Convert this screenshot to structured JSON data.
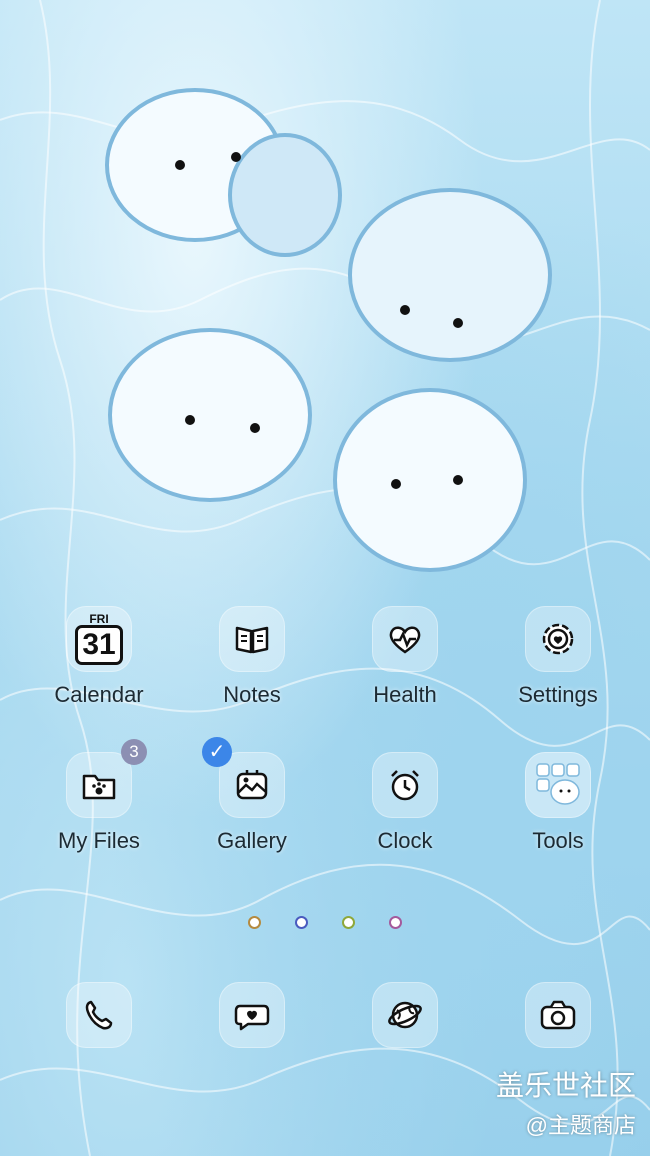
{
  "calendar": {
    "label": "Calendar",
    "weekday": "FRI",
    "day": "31"
  },
  "notes": {
    "label": "Notes"
  },
  "health": {
    "label": "Health"
  },
  "settings": {
    "label": "Settings"
  },
  "my_files": {
    "label": "My Files",
    "badge": "3"
  },
  "gallery": {
    "label": "Gallery"
  },
  "clock": {
    "label": "Clock"
  },
  "tools": {
    "label": "Tools"
  },
  "watermark": {
    "line1": "盖乐世社区",
    "line2": "@主题商店"
  },
  "colors": {
    "page_dots": [
      "#b58a3f",
      "#4a5bbf",
      "#8fa83a",
      "#a45a9c"
    ],
    "check": "#3c86e8",
    "badge": "#8c8fb3"
  }
}
